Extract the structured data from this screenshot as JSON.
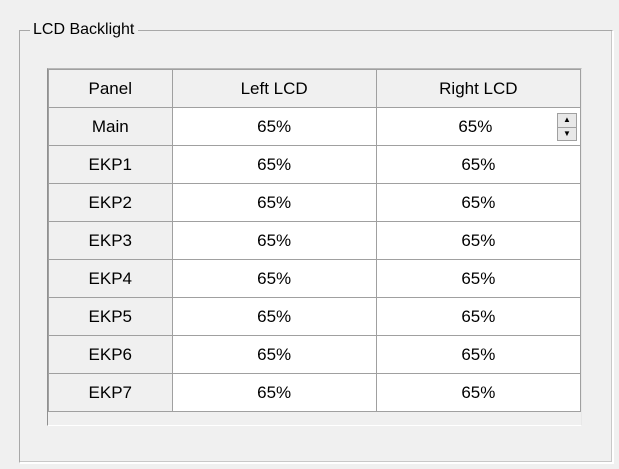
{
  "groupbox": {
    "title": "LCD Backlight"
  },
  "table": {
    "columns": [
      "Panel",
      "Left LCD",
      "Right LCD"
    ],
    "rows": [
      {
        "panel": "Main",
        "left": "65%",
        "right": "65%"
      },
      {
        "panel": "EKP1",
        "left": "65%",
        "right": "65%"
      },
      {
        "panel": "EKP2",
        "left": "65%",
        "right": "65%"
      },
      {
        "panel": "EKP3",
        "left": "65%",
        "right": "65%"
      },
      {
        "panel": "EKP4",
        "left": "65%",
        "right": "65%"
      },
      {
        "panel": "EKP5",
        "left": "65%",
        "right": "65%"
      },
      {
        "panel": "EKP6",
        "left": "65%",
        "right": "65%"
      },
      {
        "panel": "EKP7",
        "left": "65%",
        "right": "65%"
      }
    ]
  },
  "spinner": {
    "up_icon": "spin-up-arrow-icon",
    "down_icon": "spin-down-arrow-icon"
  }
}
